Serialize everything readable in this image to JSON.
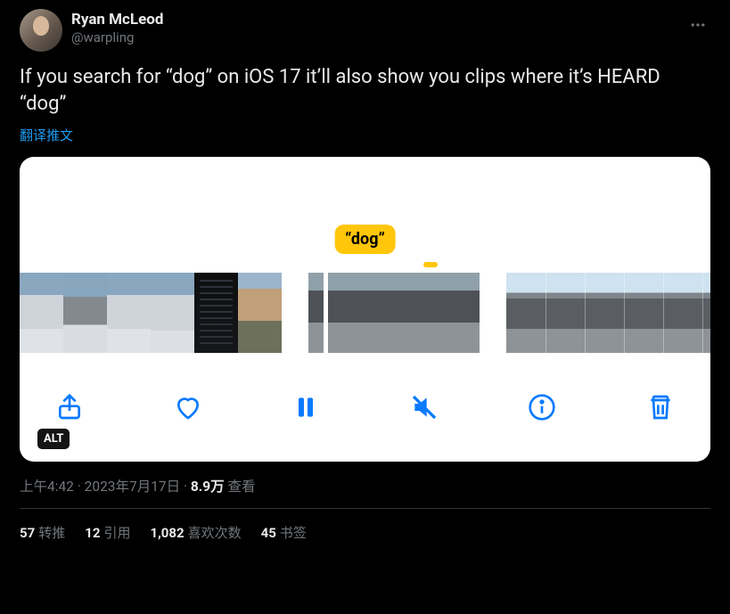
{
  "user": {
    "display_name": "Ryan McLeod",
    "handle": "@warpling"
  },
  "tweet": {
    "text": "If you search for “dog” on iOS 17 it’ll also show you clips where it’s HEARD “dog”",
    "translate": "翻译推文"
  },
  "media": {
    "label": "“dog”",
    "alt_badge": "ALT",
    "toolbar": {
      "share": "share-icon",
      "like": "heart-icon",
      "pause": "pause-icon",
      "mute": "mute-icon",
      "info": "info-icon",
      "trash": "trash-icon"
    }
  },
  "meta": {
    "time": "上午4:42",
    "dot1": " · ",
    "date": "2023年7月17日",
    "dot2": " · ",
    "views_number": "8.9万",
    "views_label": " 查看"
  },
  "stats": {
    "retweets_n": "57",
    "retweets_l": "转推",
    "quotes_n": "12",
    "quotes_l": "引用",
    "likes_n": "1,082",
    "likes_l": "喜欢次数",
    "bookmarks_n": "45",
    "bookmarks_l": "书签"
  }
}
